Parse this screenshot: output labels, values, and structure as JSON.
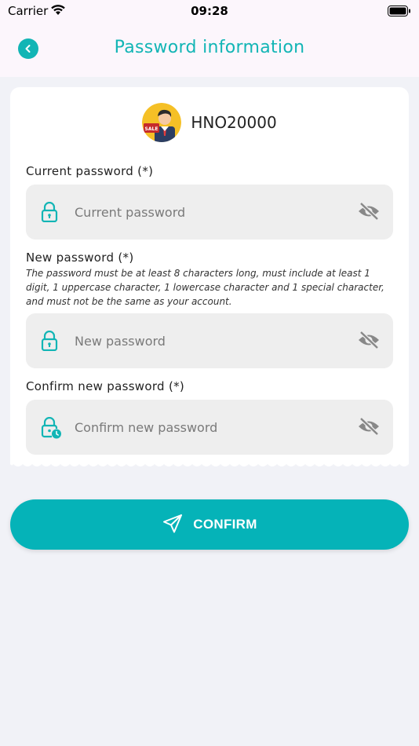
{
  "status_bar": {
    "carrier": "Carrier",
    "time": "09:28"
  },
  "header": {
    "title": "Password information"
  },
  "profile": {
    "username": "HNO20000",
    "avatar_badge": "SALE"
  },
  "form": {
    "current": {
      "label": "Current password (*)",
      "placeholder": "Current password"
    },
    "new": {
      "label": "New password (*)",
      "hint": "The password must be at least 8 characters long, must include at least 1 digit, 1 uppercase character, 1 lowercase character and 1 special character, and must not be the same as your account.",
      "placeholder": "New password"
    },
    "confirm": {
      "label": "Confirm new password (*)",
      "placeholder": "Confirm new password"
    }
  },
  "confirm_button": {
    "label": "CONFIRM"
  },
  "colors": {
    "accent": "#12b5b5",
    "button": "#05b3b8",
    "background": "#f1f2f7",
    "header_bg": "#fcf6fc"
  },
  "icons": {
    "back": "chevron-left-icon",
    "lock": "lock-icon",
    "lock_clock": "lock-clock-icon",
    "visibility_off": "eye-off-icon",
    "send": "send-icon"
  }
}
